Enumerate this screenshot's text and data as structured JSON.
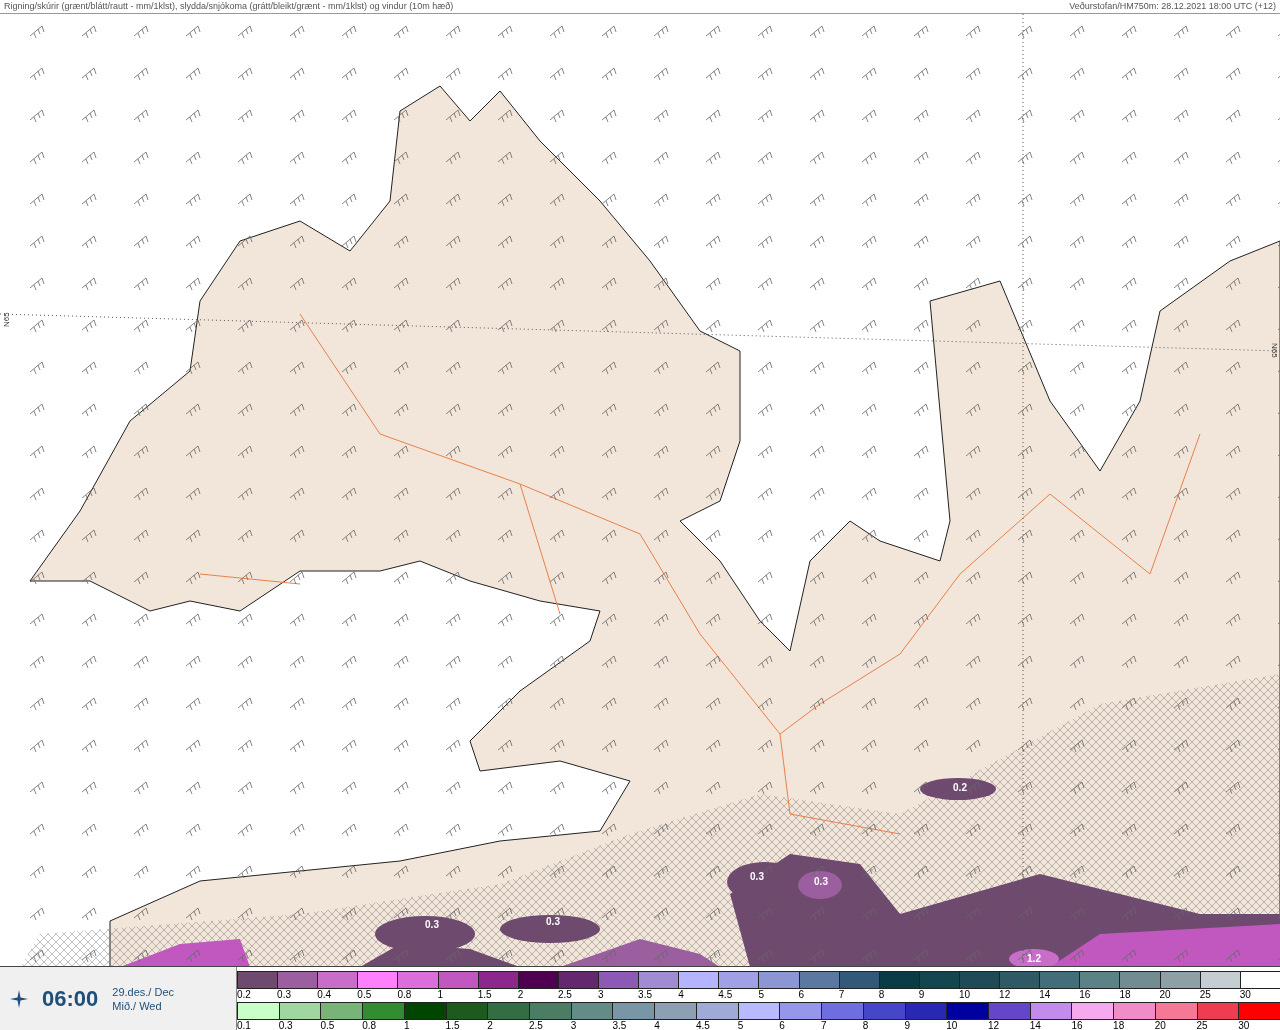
{
  "header": {
    "title": "Rigning/skúrir (grænt/blátt/rautt - mm/1klst), slydda/snjókoma (grátt/bleikt/grænt - mm/1klst) og vindur (10m hæð)",
    "source": "Veðurstofan/HM750m: 28.12.2021 18:00 UTC (+12)"
  },
  "map": {
    "latitude_labels": [
      "N65",
      "N65"
    ],
    "contour_labels": [
      "0.2",
      "0.3",
      "0.3",
      "0.3",
      "0.3",
      "1.2"
    ]
  },
  "time_panel": {
    "time": "06:00",
    "date": "29.des./ Dec",
    "weekday": "Mið./ Wed"
  },
  "legend_rows": [
    {
      "swatches": [
        {
          "label": "0.2",
          "color": "#6e4a6e"
        },
        {
          "label": "0.3",
          "color": "#9b5fa0"
        },
        {
          "label": "0.4",
          "color": "#c86ec8"
        },
        {
          "label": "0.5",
          "color": "#ff80ff"
        },
        {
          "label": "0.8",
          "color": "#dc6edc"
        },
        {
          "label": "1",
          "color": "#c058c0"
        },
        {
          "label": "1.5",
          "color": "#8c288c"
        },
        {
          "label": "2",
          "color": "#500050"
        },
        {
          "label": "2.5",
          "color": "#64286e"
        },
        {
          "label": "3",
          "color": "#8c5ab4"
        },
        {
          "label": "3.5",
          "color": "#a08cd2"
        },
        {
          "label": "4",
          "color": "#b4b4ff"
        },
        {
          "label": "4.5",
          "color": "#a0a0e6"
        },
        {
          "label": "5",
          "color": "#8c96d2"
        },
        {
          "label": "6",
          "color": "#5a78a0"
        },
        {
          "label": "7",
          "color": "#325a78"
        },
        {
          "label": "8",
          "color": "#0a3c46"
        },
        {
          "label": "9",
          "color": "#14464f"
        },
        {
          "label": "10",
          "color": "#1e4b55"
        },
        {
          "label": "12",
          "color": "#2d5a64"
        },
        {
          "label": "14",
          "color": "#416e78"
        },
        {
          "label": "16",
          "color": "#5a8287"
        },
        {
          "label": "18",
          "color": "#738c91"
        },
        {
          "label": "20",
          "color": "#8ca0a5"
        },
        {
          "label": "25",
          "color": "#c3cdd2"
        },
        {
          "label": "30",
          "color": "#ffffff"
        }
      ]
    },
    {
      "swatches": [
        {
          "label": "0.1",
          "color": "#c8ffc8"
        },
        {
          "label": "0.3",
          "color": "#a0d7a0"
        },
        {
          "label": "0.5",
          "color": "#78b478"
        },
        {
          "label": "0.8",
          "color": "#328c32"
        },
        {
          "label": "1",
          "color": "#004600"
        },
        {
          "label": "1.5",
          "color": "#1e5a1e"
        },
        {
          "label": "2",
          "color": "#326e41"
        },
        {
          "label": "2.5",
          "color": "#4b7d64"
        },
        {
          "label": "3",
          "color": "#648c87"
        },
        {
          "label": "3.5",
          "color": "#7896a5"
        },
        {
          "label": "4",
          "color": "#8ca0b4"
        },
        {
          "label": "4.5",
          "color": "#a0aad7"
        },
        {
          "label": "5",
          "color": "#b9b9ff"
        },
        {
          "label": "6",
          "color": "#9696eb"
        },
        {
          "label": "7",
          "color": "#6e6ee1"
        },
        {
          "label": "8",
          "color": "#4646c8"
        },
        {
          "label": "9",
          "color": "#2828b4"
        },
        {
          "label": "10",
          "color": "#0000a0"
        },
        {
          "label": "12",
          "color": "#6446c8"
        },
        {
          "label": "14",
          "color": "#c38cec"
        },
        {
          "label": "16",
          "color": "#f5aaf0"
        },
        {
          "label": "18",
          "color": "#f08cc8"
        },
        {
          "label": "20",
          "color": "#f57896"
        },
        {
          "label": "25",
          "color": "#f03c50"
        },
        {
          "label": "30",
          "color": "#ff0000"
        }
      ]
    }
  ]
}
